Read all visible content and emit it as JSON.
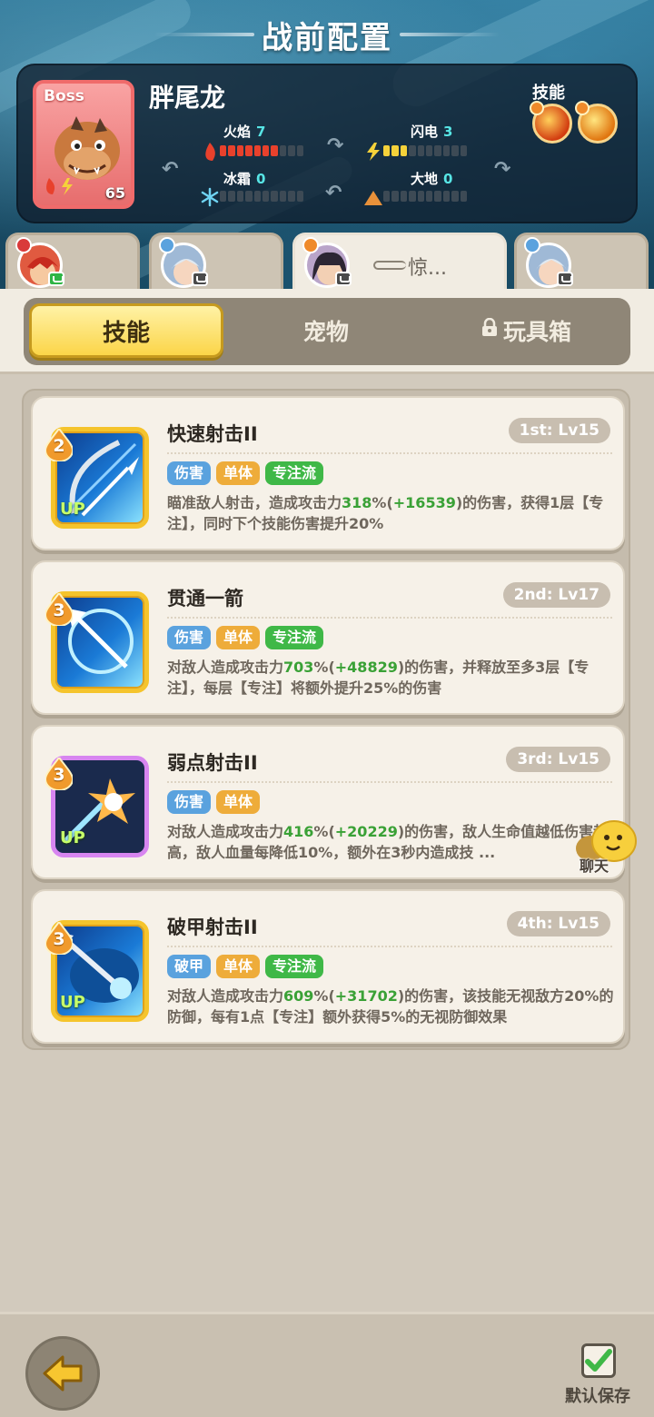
{
  "header": {
    "title": "战前配置"
  },
  "boss": {
    "tag": "Boss",
    "name": "胖尾龙",
    "level": "65",
    "skills_label": "技能",
    "elements": [
      {
        "label": "火焰",
        "value": "7",
        "max": 10,
        "color": "#e8412c"
      },
      {
        "label": "闪电",
        "value": "3",
        "max": 10,
        "color": "#f5d23a"
      },
      {
        "label": "冰霜",
        "value": "0",
        "max": 10,
        "color": "#6fd3f2"
      },
      {
        "label": "大地",
        "value": "0",
        "max": 10,
        "color": "#e8913a"
      }
    ]
  },
  "heroes": [
    {
      "name": "",
      "active": false
    },
    {
      "name": "",
      "active": false
    },
    {
      "name": "惊...",
      "active": true
    },
    {
      "name": "",
      "active": false
    }
  ],
  "tabs": {
    "skills": "技能",
    "pets": "宠物",
    "toybox": "玩具箱"
  },
  "cards": [
    {
      "rank_num": "2",
      "title": "快速射击II",
      "level_badge": "1st: Lv15",
      "up": "UP",
      "tags": [
        "伤害",
        "单体",
        "专注流"
      ],
      "desc_a": "瞄准敌人射击，造成攻击力",
      "desc_pct": "318",
      "desc_b": "%(",
      "desc_bonus": "+16539",
      "desc_c": ")的伤害，获得1层【专注】，同时下个技能伤害提升20%"
    },
    {
      "rank_num": "3",
      "title": "贯通一箭",
      "level_badge": "2nd: Lv17",
      "up": "",
      "tags": [
        "伤害",
        "单体",
        "专注流"
      ],
      "desc_a": "对敌人造成攻击力",
      "desc_pct": "703",
      "desc_b": "%(",
      "desc_bonus": "+48829",
      "desc_c": ")的伤害，并释放至多3层【专注】，每层【专注】将额外提升25%的伤害"
    },
    {
      "rank_num": "3",
      "title": "弱点射击II",
      "level_badge": "3rd: Lv15",
      "up": "UP",
      "tags": [
        "伤害",
        "单体"
      ],
      "desc_a": "对敌人造成攻击力",
      "desc_pct": "416",
      "desc_b": "%(",
      "desc_bonus": "+20229",
      "desc_c": ")的伤害，敌人生命值越低伤害越高，敌人血量每降低10%，额外在3秒内造成技 ..."
    },
    {
      "rank_num": "3",
      "title": "破甲射击II",
      "level_badge": "4th: Lv15",
      "up": "UP",
      "tags": [
        "破甲",
        "单体",
        "专注流"
      ],
      "desc_a": "对敌人造成攻击力",
      "desc_pct": "609",
      "desc_b": "%(",
      "desc_bonus": "+31702",
      "desc_c": ")的伤害，该技能无视敌方20%的防御，每有1点【专注】额外获得5%的无视防御效果"
    }
  ],
  "chat": {
    "label": "聊天"
  },
  "bottom": {
    "save_label": "默认保存"
  },
  "colors": {
    "accent_yellow": "#fbd548",
    "tag_blue": "#5aa2de",
    "tag_orange": "#eeac3a",
    "tag_green": "#3fb847",
    "value_green": "#3aa136"
  }
}
